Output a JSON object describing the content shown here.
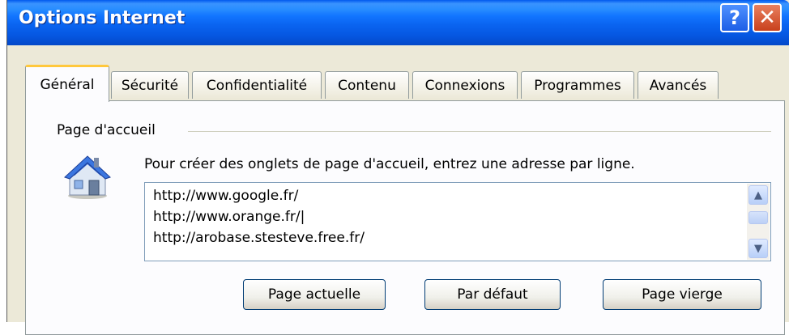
{
  "window": {
    "title": "Options Internet",
    "help_label": "?",
    "close_label": "✕"
  },
  "tabs": [
    {
      "label": "Général",
      "active": true
    },
    {
      "label": "Sécurité"
    },
    {
      "label": "Confidentialité"
    },
    {
      "label": "Contenu"
    },
    {
      "label": "Connexions"
    },
    {
      "label": "Programmes"
    },
    {
      "label": "Avancés"
    }
  ],
  "homepage": {
    "group_label": "Page d'accueil",
    "instruction": "Pour créer des onglets de page d'accueil, entrez une adresse par ligne.",
    "urls": [
      "http://www.google.fr/",
      "http://www.orange.fr/|",
      "http://arobase.stesteve.free.fr/"
    ],
    "buttons": {
      "current": "Page actuelle",
      "default": "Par défaut",
      "blank": "Page vierge"
    }
  },
  "icons": {
    "home": "house-icon",
    "help": "help-icon",
    "close": "close-icon",
    "scroll_up": "chevron-up-icon",
    "scroll_down": "chevron-down-icon"
  },
  "colors": {
    "titlebar": "#0a64f0",
    "active_tab_accent": "#ffc83c",
    "close_button": "#c8401c",
    "dialog_bg": "#ece9d8"
  }
}
